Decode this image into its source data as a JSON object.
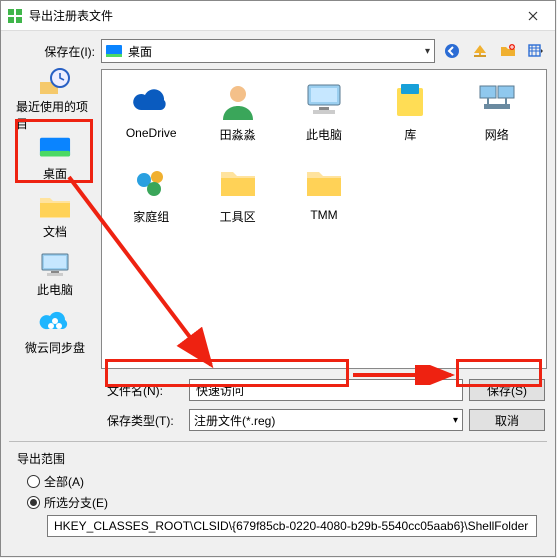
{
  "window": {
    "title": "导出注册表文件"
  },
  "savein": {
    "label": "保存在(I):",
    "value": "桌面"
  },
  "places": {
    "recent": "最近使用的项目",
    "desktop": "桌面",
    "documents": "文档",
    "thispc": "此电脑",
    "weibo": "微云同步盘"
  },
  "files": [
    "OneDrive",
    "田淼淼",
    "此电脑",
    "库",
    "网络",
    "家庭组",
    "工具区",
    "TMM"
  ],
  "filename": {
    "label": "文件名(N):",
    "value": "快速访问"
  },
  "filetype": {
    "label": "保存类型(T):",
    "value": "注册文件(*.reg)"
  },
  "buttons": {
    "save": "保存(S)",
    "cancel": "取消"
  },
  "export": {
    "title": "导出范围",
    "all": "全部(A)",
    "branch": "所选分支(E)",
    "path": "HKEY_CLASSES_ROOT\\CLSID\\{679f85cb-0220-4080-b29b-5540cc05aab6}\\ShellFolder"
  }
}
